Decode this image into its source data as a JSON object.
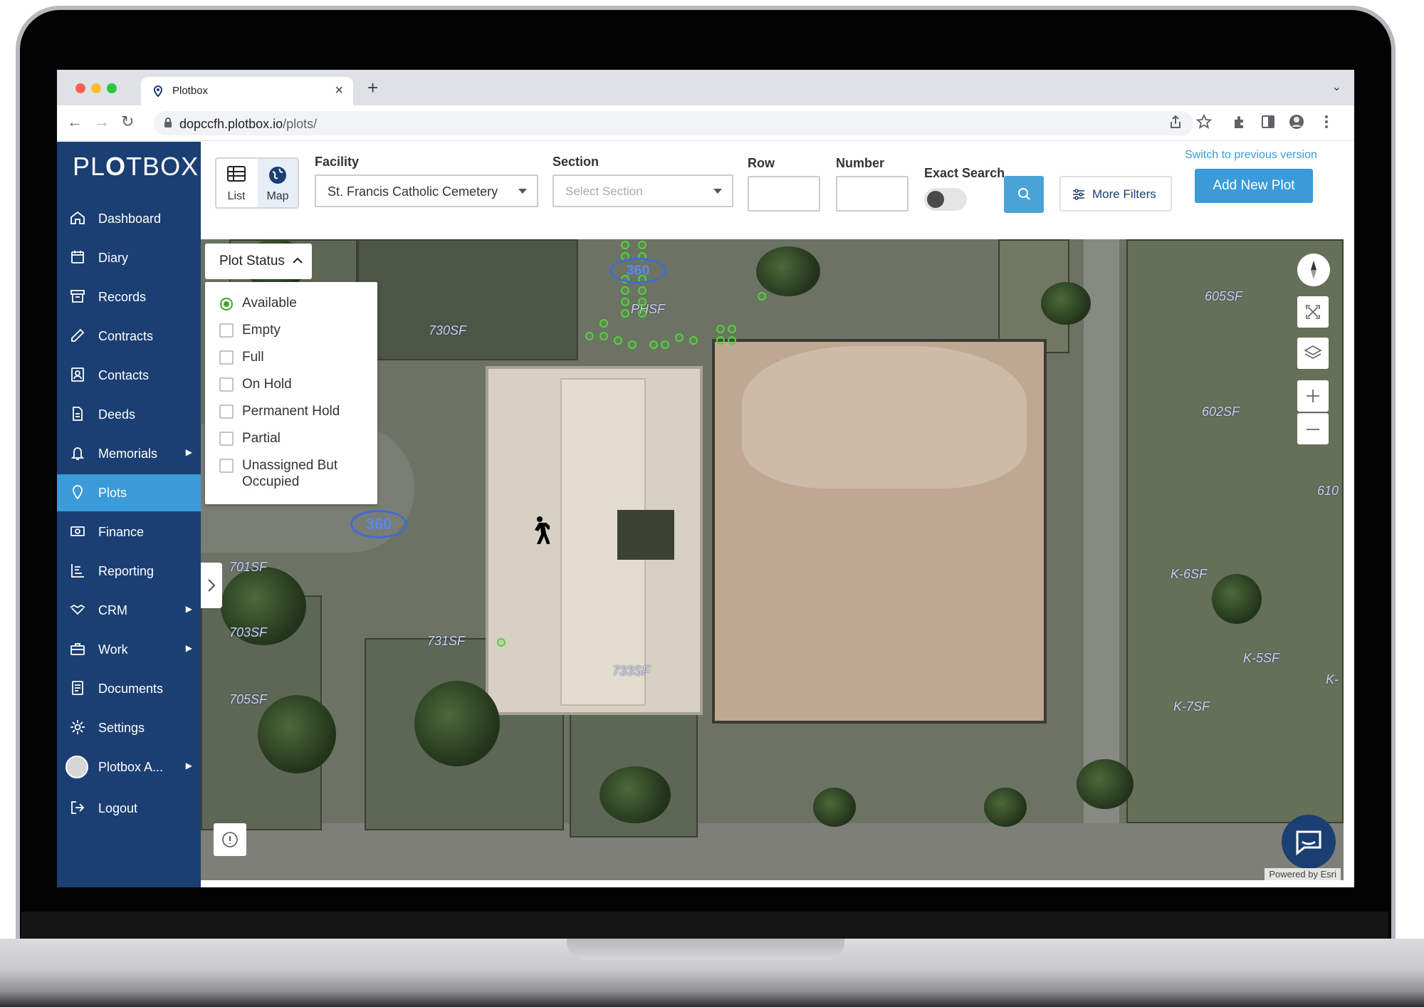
{
  "browser": {
    "tab_title": "Plotbox",
    "url_host": "dopccfh.plotbox.io",
    "url_path": "/plots/",
    "new_tab": "+",
    "close_tab": "×"
  },
  "sidebar": {
    "logo_a": "PL",
    "logo_b": "O",
    "logo_c": "TBOX",
    "items": [
      {
        "label": "Dashboard",
        "icon": "home-icon"
      },
      {
        "label": "Diary",
        "icon": "calendar-icon"
      },
      {
        "label": "Records",
        "icon": "archive-icon"
      },
      {
        "label": "Contracts",
        "icon": "pen-icon"
      },
      {
        "label": "Contacts",
        "icon": "contact-card-icon"
      },
      {
        "label": "Deeds",
        "icon": "document-icon"
      },
      {
        "label": "Memorials",
        "icon": "bell-icon",
        "has_submenu": true
      },
      {
        "label": "Plots",
        "icon": "map-pin-icon",
        "active": true
      },
      {
        "label": "Finance",
        "icon": "banknote-icon"
      },
      {
        "label": "Reporting",
        "icon": "chart-icon"
      },
      {
        "label": "CRM",
        "icon": "handshake-icon",
        "has_submenu": true
      },
      {
        "label": "Work",
        "icon": "toolbox-icon",
        "has_submenu": true
      },
      {
        "label": "Documents",
        "icon": "documents-icon"
      },
      {
        "label": "Settings",
        "icon": "gear-icon"
      },
      {
        "label": "Plotbox A...",
        "icon": "avatar",
        "has_submenu": true
      },
      {
        "label": "Logout",
        "icon": "logout-icon"
      }
    ],
    "accent": "#3a9bd8",
    "background": "#1c3f73"
  },
  "filters": {
    "view_toggle": {
      "list_label": "List",
      "map_label": "Map",
      "selected": "Map"
    },
    "facility": {
      "label": "Facility",
      "value": "St. Francis Catholic Cemetery"
    },
    "section": {
      "label": "Section",
      "placeholder": "Select Section"
    },
    "row": {
      "label": "Row",
      "value": ""
    },
    "number": {
      "label": "Number",
      "value": ""
    },
    "exact_search": {
      "label": "Exact Search",
      "on": false
    },
    "more_filters_label": "More Filters",
    "add_new_plot_label": "Add New Plot",
    "switch_version_label": "Switch to previous version"
  },
  "map": {
    "plot_status": {
      "button_label": "Plot Status",
      "options": [
        {
          "label": "Available",
          "selected": true
        },
        {
          "label": "Empty",
          "selected": false
        },
        {
          "label": "Full",
          "selected": false
        },
        {
          "label": "On Hold",
          "selected": false
        },
        {
          "label": "Permanent Hold",
          "selected": false
        },
        {
          "label": "Partial",
          "selected": false
        },
        {
          "label": "Unassigned But Occupied",
          "selected": false
        }
      ]
    },
    "plot_labels": [
      "730SF",
      "605SF",
      "602SF",
      "610",
      "701SF",
      "703SF",
      "731SF",
      "733SF",
      "705SF",
      "K-6SF",
      "K-5SF",
      "K-7SF",
      "K-",
      "PHSF"
    ],
    "panorama_label": "360",
    "attribution": "Powered by Esri"
  }
}
